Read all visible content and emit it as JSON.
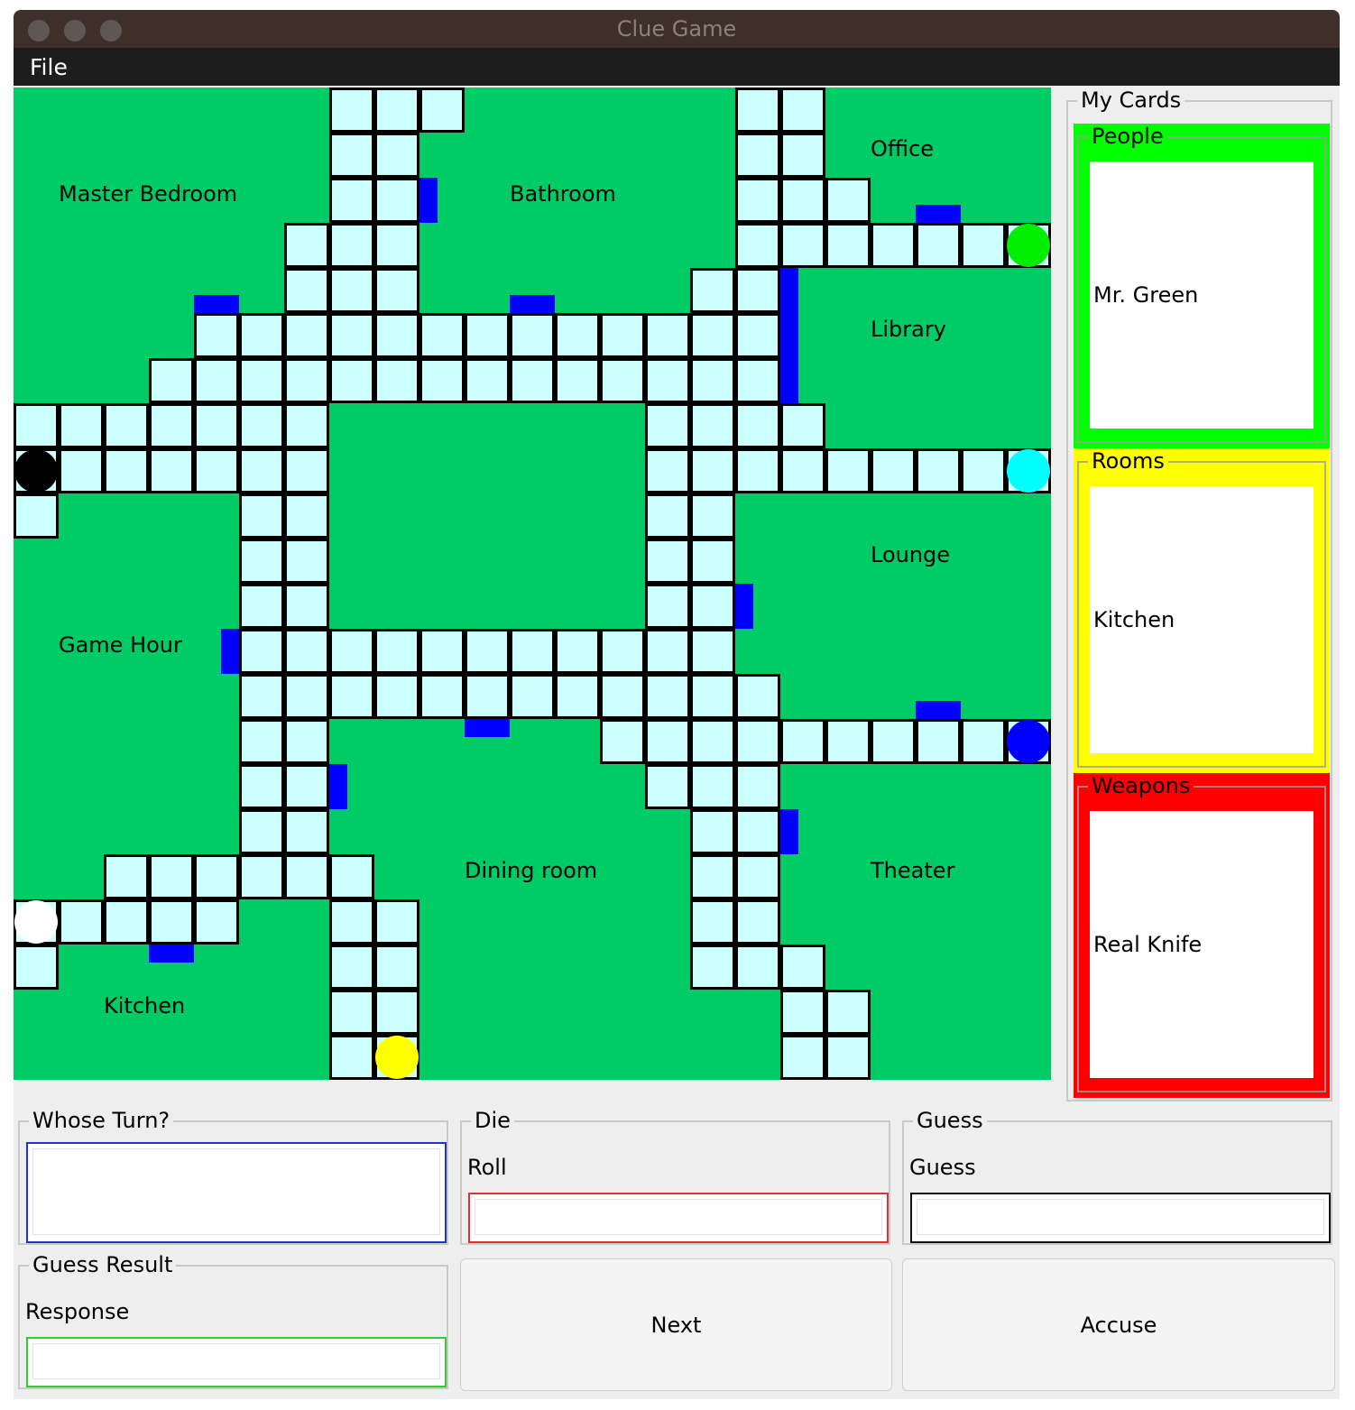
{
  "window": {
    "title": "Clue Game"
  },
  "menu": {
    "file": "File"
  },
  "board": {
    "colors": {
      "room": "#00cc66",
      "walkway": "#ccffff",
      "door": "#0000ff",
      "grid": "#000000"
    },
    "rooms": [
      {
        "name": "Master Bedroom"
      },
      {
        "name": "Bathroom"
      },
      {
        "name": "Office"
      },
      {
        "name": "Library"
      },
      {
        "name": "Lounge"
      },
      {
        "name": "Game Hour"
      },
      {
        "name": "Dining room"
      },
      {
        "name": "Theater"
      },
      {
        "name": "Kitchen"
      }
    ],
    "players": [
      {
        "color": "#00ee00"
      },
      {
        "color": "#00ffff"
      },
      {
        "color": "#000000"
      },
      {
        "color": "#0000ff"
      },
      {
        "color": "#ffffff"
      },
      {
        "color": "#ffff00"
      }
    ]
  },
  "my_cards": {
    "title": "My Cards",
    "people": {
      "title": "People",
      "card": "Mr. Green",
      "color": "#00ff00"
    },
    "rooms": {
      "title": "Rooms",
      "card": "Kitchen",
      "color": "#ffff00"
    },
    "weapons": {
      "title": "Weapons",
      "card": "Real Knife",
      "color": "#ff0000"
    }
  },
  "controls": {
    "whose_turn": {
      "title": "Whose Turn?",
      "value": ""
    },
    "die": {
      "title": "Die",
      "label": "Roll",
      "value": ""
    },
    "guess": {
      "title": "Guess",
      "label": "Guess",
      "value": ""
    },
    "guess_result": {
      "title": "Guess Result",
      "label": "Response",
      "value": ""
    },
    "next_button": "Next",
    "accuse_button": "Accuse"
  }
}
